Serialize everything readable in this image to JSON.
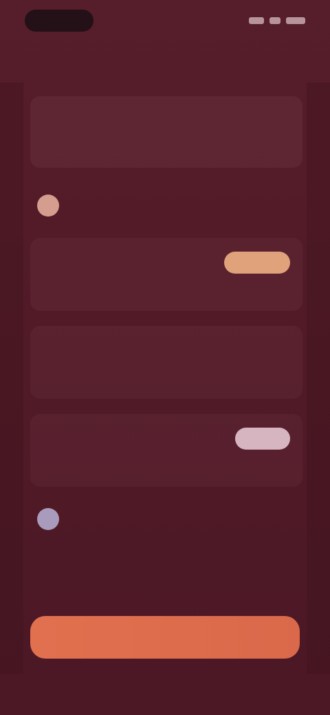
{
  "theme": {
    "background": "#521c28",
    "accent": "#e1704f",
    "pill_gold": "#e0a27a",
    "pill_lilac": "#d7b5c0"
  },
  "nav": {
    "back_label": "",
    "action_label": ""
  },
  "intro": {
    "title": "",
    "subtitle": ""
  },
  "section_primary": {
    "icon": "warm-circle-icon",
    "label": "",
    "sublabel": ""
  },
  "options_primary": [
    {
      "title": "",
      "description": "",
      "badge": ""
    },
    {
      "title": "",
      "description": ""
    },
    {
      "title": "",
      "description": "",
      "badge": ""
    }
  ],
  "section_secondary": {
    "icon": "cool-circle-icon",
    "label": "",
    "sublabel": ""
  },
  "footer_note": "",
  "cta": {
    "label": "",
    "caption": ""
  }
}
